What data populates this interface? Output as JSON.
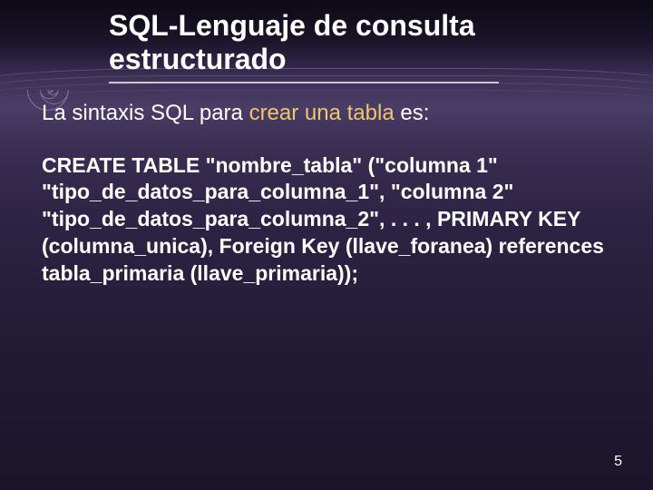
{
  "title_line1": "SQL-Lenguaje de consulta",
  "title_line2": "estructurado",
  "subtitle_prefix": "La sintaxis SQL para  ",
  "subtitle_highlight": "crear una tabla",
  "subtitle_suffix": " es:",
  "code_text": "CREATE TABLE \"nombre_tabla\" (\"columna 1\" \"tipo_de_datos_para_columna_1\", \"columna 2\" \"tipo_de_datos_para_columna_2\", . . . , PRIMARY KEY (columna_unica), Foreign Key (llave_foranea) references tabla_primaria (llave_primaria));",
  "page_number": "5"
}
